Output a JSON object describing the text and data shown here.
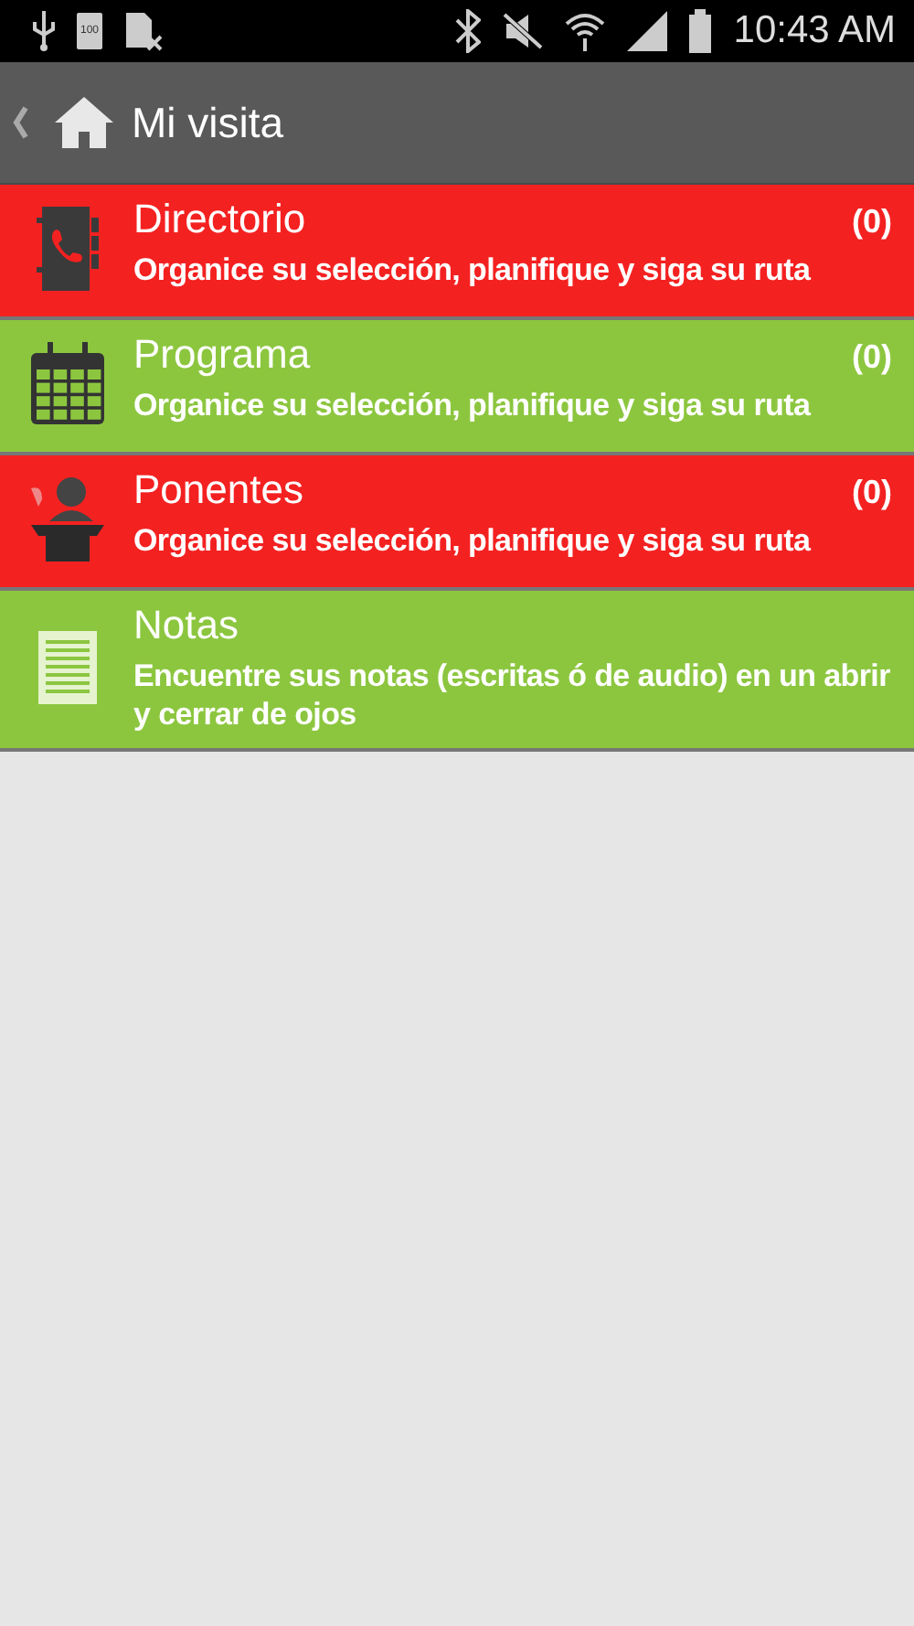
{
  "status_bar": {
    "battery_badge": "100",
    "time": "10:43 AM"
  },
  "app_bar": {
    "title": "Mi visita"
  },
  "items": [
    {
      "kind": "directory",
      "color": "#f42121",
      "title": "Directorio",
      "count": "(0)",
      "description": "Organice su selección, planifique y siga su ruta"
    },
    {
      "kind": "calendar",
      "color": "#8cc63f",
      "title": "Programa",
      "count": "(0)",
      "description": "Organice su selección, planifique y siga su ruta"
    },
    {
      "kind": "speaker",
      "color": "#f42121",
      "title": "Ponentes",
      "count": "(0)",
      "description": "Organice su selección, planifique y siga su ruta"
    },
    {
      "kind": "notes",
      "color": "#8cc63f",
      "title": "Notas",
      "description": "Encuentre sus notas (escritas ó de audio) en un abrir y cerrar de ojos"
    }
  ]
}
